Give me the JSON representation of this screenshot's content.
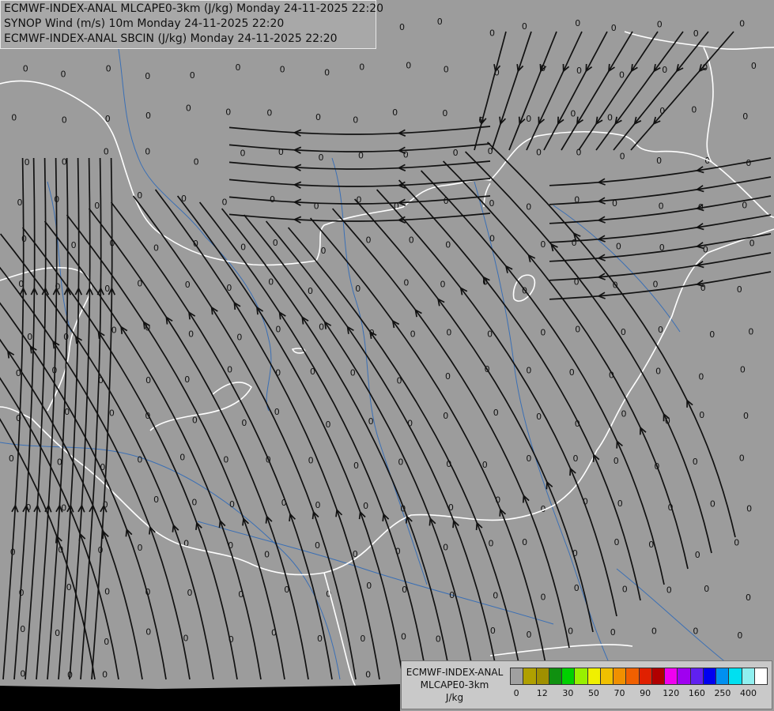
{
  "header": {
    "line1": "ECMWF-INDEX-ANAL MLCAPE0-3km (J/kg) Monday 24-11-2025 22:20",
    "line2": "SYNOP Wind (m/s) 10m Monday 24-11-2025 22:20",
    "line3": "ECMWF-INDEX-ANAL SBCIN (J/kg) Monday 24-11-2025 22:20"
  },
  "legend": {
    "line1": "ECMWF-INDEX-ANAL",
    "line2": "MLCAPE0-3km",
    "line3": "J/kg",
    "colors": [
      "#a0a0a0",
      "#b0a000",
      "#a09000",
      "#109010",
      "#00d000",
      "#98f000",
      "#f0f000",
      "#f0c000",
      "#f09000",
      "#f06000",
      "#e02000",
      "#b00000",
      "#f000f0",
      "#a000f0",
      "#6020f0",
      "#0000f0",
      "#0090f0",
      "#00e0f0",
      "#90f0f0",
      "#ffffff"
    ],
    "ticks": [
      "0",
      "12",
      "30",
      "50",
      "70",
      "90",
      "120",
      "160",
      "250",
      "400"
    ]
  },
  "map": {
    "field_label": "0",
    "colors": {
      "background": "#9c9c9c",
      "streamline": "#111111",
      "border": "#ffffff",
      "river": "#3a6fb5",
      "no_data": "#000000"
    }
  }
}
